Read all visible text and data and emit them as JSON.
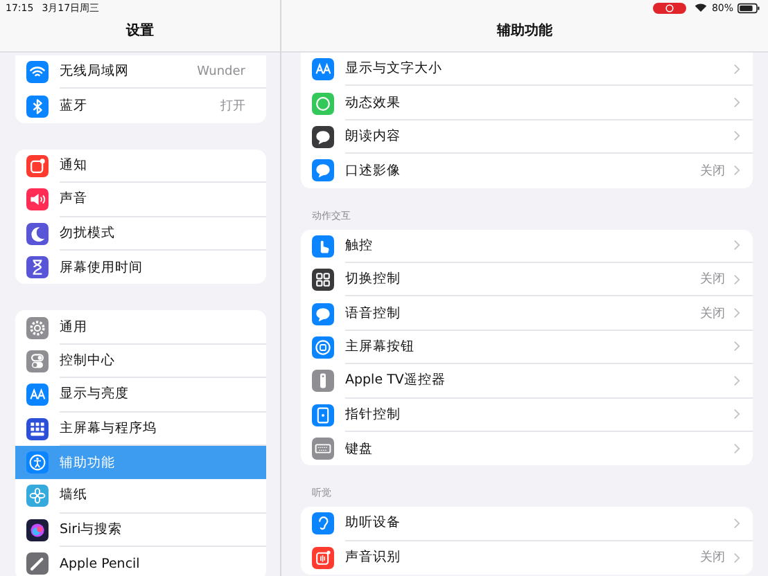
{
  "status_bar": {
    "time": "17:15",
    "date": "3月17日周三",
    "battery": "80%",
    "recording": true
  },
  "sidebar": {
    "title": "设置",
    "groups": [
      [
        {
          "label": "无线局域网",
          "value": "Wunder",
          "color": "#0a84ff",
          "selected": false
        },
        {
          "label": "蓝牙",
          "value": "打开",
          "color": "#0a84ff",
          "selected": false
        }
      ],
      [
        {
          "label": "通知",
          "color": "#ff3b30",
          "selected": false
        },
        {
          "label": "声音",
          "color": "#ff2d55",
          "selected": false
        },
        {
          "label": "勿扰模式",
          "color": "#5856d6",
          "selected": false
        },
        {
          "label": "屏幕使用时间",
          "color": "#5856d6",
          "selected": false
        }
      ],
      [
        {
          "label": "通用",
          "color": "#8e8e93",
          "selected": false
        },
        {
          "label": "控制中心",
          "color": "#8e8e93",
          "selected": false
        },
        {
          "label": "显示与亮度",
          "color": "#0a84ff",
          "selected": false
        },
        {
          "label": "主屏幕与程序坞",
          "color": "#2c4fd8",
          "selected": false
        },
        {
          "label": "辅助功能",
          "color": "#0a84ff",
          "selected": true
        },
        {
          "label": "墙纸",
          "color": "#35aadc",
          "selected": false
        },
        {
          "label": "Siri与搜索",
          "color": "#1c1c3c",
          "selected": false
        },
        {
          "label": "Apple Pencil",
          "color": "#6e6e73",
          "selected": false
        }
      ]
    ]
  },
  "detail": {
    "title": "辅助功能",
    "sections": [
      {
        "rows": [
          {
            "label": "显示与文字大小",
            "color": "#0a84ff"
          },
          {
            "label": "动态效果",
            "color": "#34c759"
          },
          {
            "label": "朗读内容",
            "color": "#3a3a3c"
          },
          {
            "label": "口述影像",
            "value": "关闭",
            "color": "#0a84ff"
          }
        ]
      },
      {
        "header": "动作交互",
        "rows": [
          {
            "label": "触控",
            "color": "#0a84ff"
          },
          {
            "label": "切换控制",
            "value": "关闭",
            "color": "#3a3a3c"
          },
          {
            "label": "语音控制",
            "value": "关闭",
            "color": "#0a84ff"
          },
          {
            "label": "主屏幕按钮",
            "color": "#0a84ff"
          },
          {
            "label": "Apple TV遥控器",
            "color": "#8e8e93"
          },
          {
            "label": "指针控制",
            "color": "#0a84ff"
          },
          {
            "label": "键盘",
            "color": "#8e8e93"
          }
        ]
      },
      {
        "header": "听觉",
        "rows": [
          {
            "label": "助听设备",
            "color": "#0a84ff"
          },
          {
            "label": "声音识别",
            "value": "关闭",
            "color": "#ff3b30"
          }
        ]
      }
    ]
  }
}
